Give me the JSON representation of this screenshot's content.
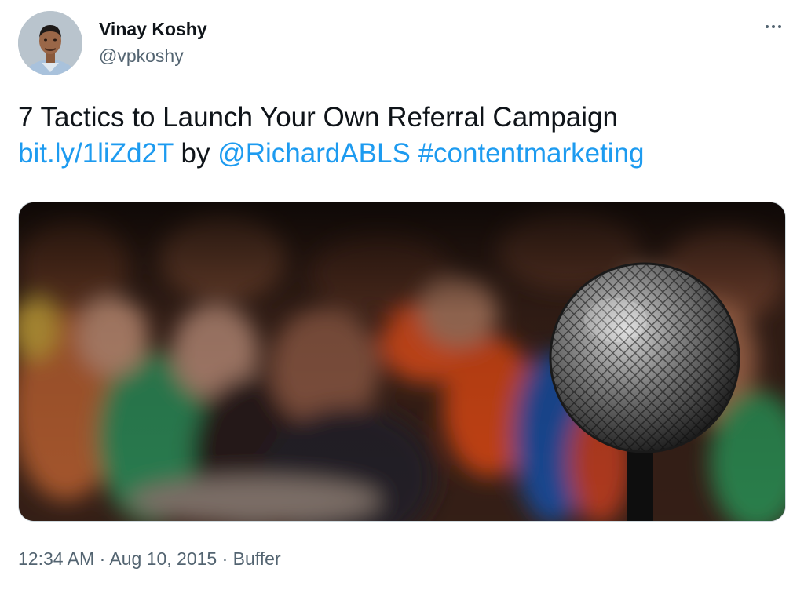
{
  "author": {
    "display_name": "Vinay Koshy",
    "handle": "@vpkoshy",
    "avatar_icon": "person-avatar"
  },
  "more_icon": "more-horizontal-icon",
  "tweet": {
    "text_line1": "7 Tactics to Launch Your Own Referral Campaign",
    "link": "bit.ly/1liZd2T",
    "by_word": " by ",
    "mention": "@RichardABLS",
    "space": " ",
    "hashtag": "#contentmarketing"
  },
  "media": {
    "description_icon": "microphone-crowd-image"
  },
  "meta": {
    "time": "12:34 AM",
    "sep1": " · ",
    "date": "Aug 10, 2015",
    "sep2": " · ",
    "source": "Buffer"
  },
  "colors": {
    "link": "#1d9bf0",
    "secondary_text": "#536471",
    "primary_text": "#0f1419"
  }
}
